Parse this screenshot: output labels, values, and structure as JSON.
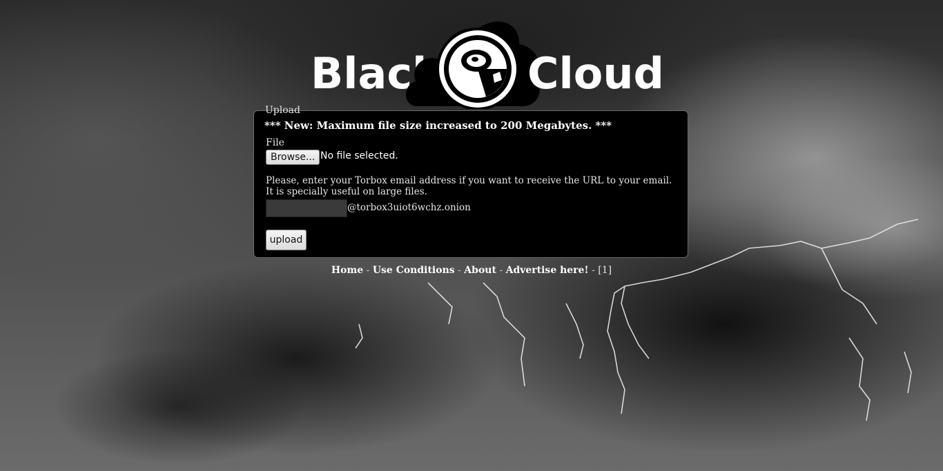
{
  "brand": {
    "left_text": "Black",
    "right_text": "Cloud",
    "logo_icon": "cloud-disc-logo-icon"
  },
  "upload": {
    "legend": "Upload",
    "notice": "*** New: Maximum file size increased to 200 Megabytes. ***",
    "file_label": "File",
    "browse_label": "Browse...",
    "no_file_text": "No file selected.",
    "help_line1": "Please, enter your Torbox email address if you want to receive the URL to your email.",
    "help_line2": "It is specially useful on large files.",
    "email_value": "",
    "email_domain": "@torbox3uiot6wchz.onion",
    "upload_label": "upload"
  },
  "footer": {
    "links": [
      "Home",
      "Use Conditions",
      "About",
      "Advertise here!"
    ],
    "separator": "-",
    "suffix": "[1]"
  },
  "colors": {
    "panel_bg": "#000000",
    "text": "#e6e6e6",
    "brand": "#ffffff"
  }
}
